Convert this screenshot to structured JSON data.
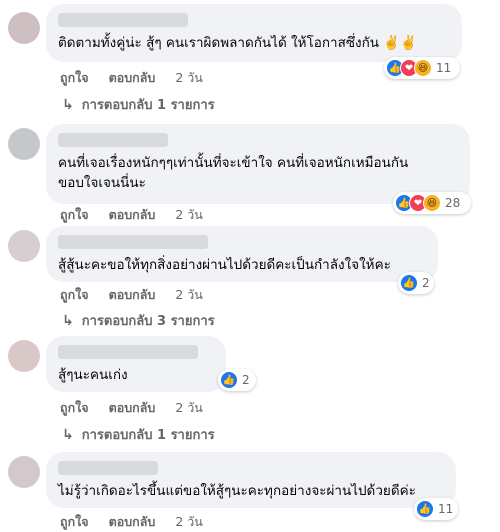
{
  "comments": [
    {
      "text": "ติดตามทั้งคู่น่ะ สู้ๆ คนเราผิดพลาดกันได้ ให้โอกาสซึ่งกัน ✌️✌️",
      "reaction_count": "11",
      "like_label": "ถูกใจ",
      "reply_label": "ตอบกลับ",
      "time": "2 วัน",
      "replies_label": "การตอบกลับ 1 รายการ"
    },
    {
      "text": "คนที่เจอเรื่องหนักๆๆเท่านั้นที่จะเข้าใจ คนที่เจอหนักเหมือนกัน\nขอบใจเจนนี่นะ",
      "reaction_count": "28",
      "like_label": "ถูกใจ",
      "reply_label": "ตอบกลับ",
      "time": "2 วัน"
    },
    {
      "text": "สู้สู้นะคะขอให้ทุกสิ่งอย่างผ่านไปด้วยดีคะเป็นกำลังใจให้คะ",
      "reaction_count": "2",
      "like_label": "ถูกใจ",
      "reply_label": "ตอบกลับ",
      "time": "2 วัน",
      "replies_label": "การตอบกลับ 3 รายการ"
    },
    {
      "text": "สู้ๆนะคนเก่ง",
      "reaction_count": "2",
      "like_label": "ถูกใจ",
      "reply_label": "ตอบกลับ",
      "time": "2 วัน",
      "replies_label": "การตอบกลับ 1 รายการ"
    },
    {
      "text": "ไม่รู้ว่าเกิดอะไรขึ้นแต่ขอให้สู้ๆนะคะทุกอย่างจะผ่านไปด้วยดีค่ะ",
      "reaction_count": "11",
      "like_label": "ถูกใจ",
      "reply_label": "ตอบกลับ",
      "time": "2 วัน"
    }
  ],
  "colors": {
    "bubble": "#f0f2f5",
    "meta": "#65676b",
    "like": "#1877f2",
    "love": "#f33e58",
    "haha": "#f7b125"
  }
}
